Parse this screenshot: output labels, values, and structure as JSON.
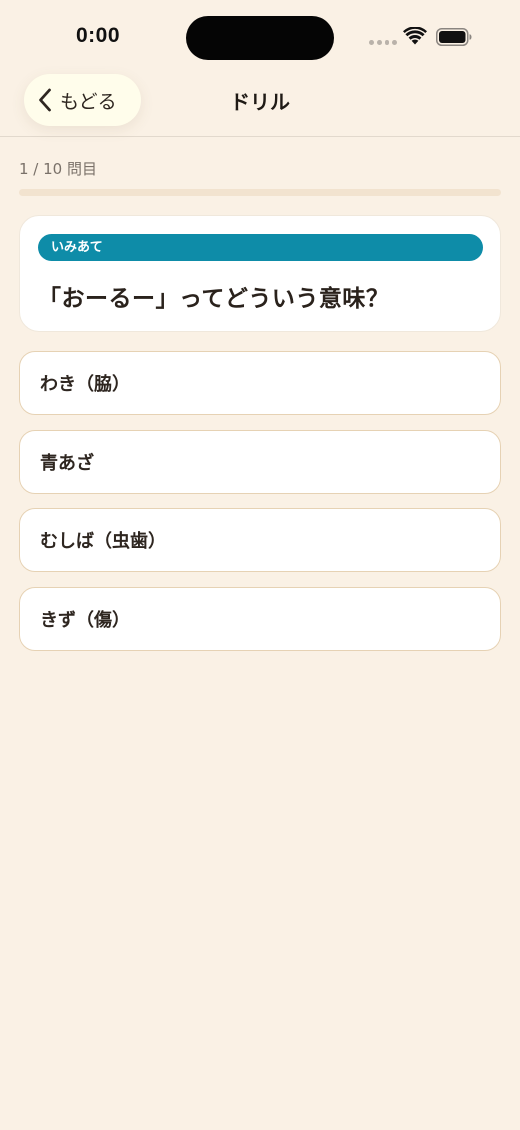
{
  "status_bar": {
    "time": "0:00"
  },
  "nav": {
    "back_label": "もどる",
    "title": "ドリル"
  },
  "progress": {
    "text": "1 / 10 問目",
    "current": 1,
    "total": 10,
    "fill_fraction": 0
  },
  "question": {
    "category": "いみあて",
    "text": "「おーるー」ってどういう意味？"
  },
  "options": [
    {
      "label": "わき（脇）"
    },
    {
      "label": "青あざ"
    },
    {
      "label": "むしば（虫歯）"
    },
    {
      "label": "きず（傷）"
    }
  ],
  "colors": {
    "background": "#FAF1E5",
    "badge": "#0E8CA8",
    "option_border": "#E6D2B4",
    "progress_track": "#F2E3CF",
    "back_button": "#FFFDEB"
  },
  "icons": {
    "back": "chevron-left-icon",
    "signal": "cellular-signal-icon",
    "wifi": "wifi-icon",
    "battery": "battery-icon"
  }
}
